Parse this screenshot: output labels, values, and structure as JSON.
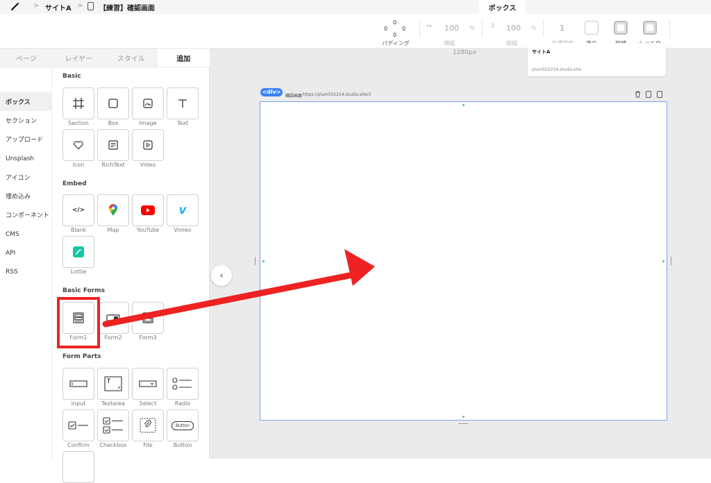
{
  "topbar": {
    "site": "サイトA",
    "page": "【練習】確認画面",
    "tab": "ボックス",
    "sep": ">"
  },
  "toolbar": {
    "padding_label": "パディング",
    "padding_values": [
      "0",
      "0",
      "0",
      "0"
    ],
    "width_value": "100",
    "width_unit": "%",
    "width_label": "横幅",
    "height_value": "100",
    "height_unit": "%",
    "height_label": "縦幅",
    "opacity_value": "1",
    "opacity_label": "不透明度",
    "fill_label": "塗り",
    "border_label": "枠線",
    "shadow_label": "シャドウ"
  },
  "canvas": {
    "ruler_label": "1280px",
    "preview_title": "サイトA",
    "preview_url": "plum502254.studio.site",
    "badge": "<div>",
    "frame_title": "確認画面",
    "frame_url": "https://plum502254.studio.site/3",
    "collapse": "‹"
  },
  "panel_tabs": [
    "ページ",
    "レイヤー",
    "スタイル",
    "追加"
  ],
  "side_items": [
    "ボックス",
    "セクション",
    "アップロード",
    "Unsplash",
    "アイコン",
    "埋め込み",
    "コンポーネント",
    "CMS",
    "API",
    "RSS"
  ],
  "sections": {
    "basic": "Basic",
    "embed": "Embed",
    "basic_forms": "Basic Forms",
    "form_parts": "Form Parts"
  },
  "tiles": {
    "basic": [
      "Section",
      "Box",
      "Image",
      "Text",
      "Icon",
      "RichText",
      "Video"
    ],
    "embed": [
      "Blank",
      "Map",
      "YouTube",
      "Vimeo",
      "Lottie"
    ],
    "basic_forms": [
      "Form1",
      "Form2",
      "Form3"
    ],
    "form_parts": [
      "Input",
      "Textarea",
      "Select",
      "Radio",
      "Confirm",
      "Checkbox",
      "File",
      "Button"
    ]
  },
  "button_tile_text": "Button",
  "colors": {
    "accent": "#3b82f6",
    "annotation": "#ee2222",
    "youtube": "#ff0000",
    "vimeo": "#1ab7ea",
    "lottie": "#19c7a6"
  }
}
